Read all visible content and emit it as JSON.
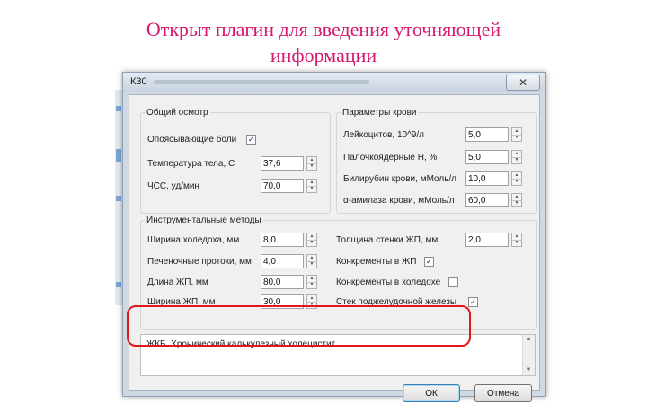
{
  "slide": {
    "title_line1": "Открыт плагин для введения уточняющей",
    "title_line2": "информации"
  },
  "dialog": {
    "title": "К30",
    "close_label": "✕",
    "general_exam": {
      "legend": "Общий осмотр",
      "pain_label": "Опоясывающие боли",
      "pain_checked": "✓",
      "temp_label": "Температура тела, С",
      "temp_value": "37,6",
      "hr_label": "ЧСС, уд/мин",
      "hr_value": "70,0"
    },
    "blood": {
      "legend": "Параметры крови",
      "leuko_label": "Лейкоцитов, 10^9/л",
      "leuko_value": "5,0",
      "stab_label": "Палочкоядерные Н, %",
      "stab_value": "5,0",
      "bili_label": "Билирубин крови, мМоль/л",
      "bili_value": "10,0",
      "amyl_label": "α-амилаза крови, мМоль/л",
      "amyl_value": "60,0"
    },
    "instrumental": {
      "legend": "Инструментальные методы",
      "choledoch_label": "Ширина холедоха, мм",
      "choledoch_value": "8,0",
      "hepatic_label": "Печеночные протоки, мм",
      "hepatic_value": "4,0",
      "gb_length_label": "Длина ЖП, мм",
      "gb_length_value": "80,0",
      "gb_width_label": "Ширина ЖП, мм",
      "gb_width_value": "30,0",
      "gb_wall_label": "Толщина стенки ЖП, мм",
      "gb_wall_value": "2,0",
      "stones_gb_label": "Конкременты в ЖП",
      "stones_gb_checked": "✓",
      "stones_chol_label": "Конкременты в холедохе",
      "stones_chol_checked": "",
      "pancreas_label": "Стек поджелудочной железы",
      "pancreas_checked": "✓"
    },
    "notes_text": "ЖКБ. Хронический калькулезный холецистит.",
    "ok_label": "ОК",
    "cancel_label": "Отмена"
  }
}
